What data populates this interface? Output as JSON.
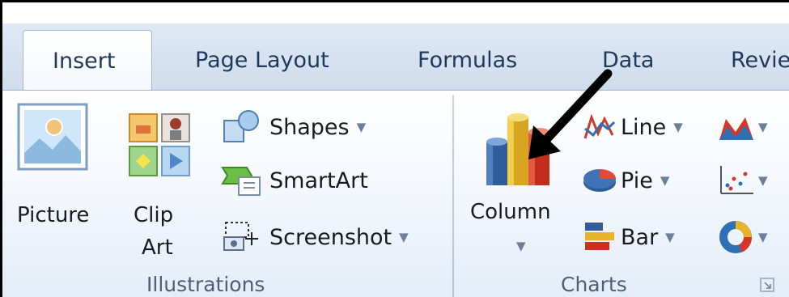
{
  "tabs": [
    {
      "label": "Insert",
      "active": true
    },
    {
      "label": "Page Layout",
      "active": false
    },
    {
      "label": "Formulas",
      "active": false
    },
    {
      "label": "Data",
      "active": false
    },
    {
      "label": "Revie",
      "active": false
    }
  ],
  "illustrations": {
    "picture_label": "Picture",
    "clip_label_1": "Clip",
    "clip_label_2": "Art",
    "shapes_label": "Shapes",
    "smartart_label": "SmartArt",
    "screenshot_label": "Screenshot",
    "group_label": "Illustrations"
  },
  "charts": {
    "column_label": "Column",
    "line_label": "Line",
    "pie_label": "Pie",
    "bar_label": "Bar",
    "group_label": "Charts"
  },
  "colors": {
    "tab_text": "#1e395b",
    "ribbon_bg": "#e3ecf7",
    "arrow": "#000000"
  }
}
